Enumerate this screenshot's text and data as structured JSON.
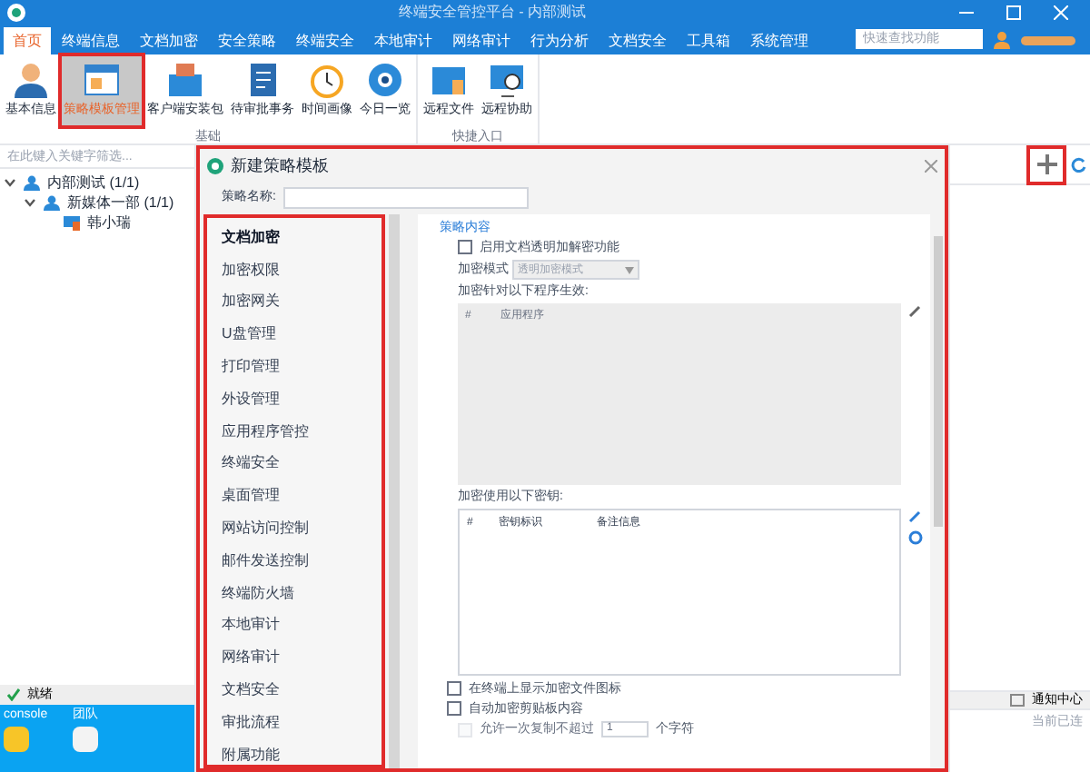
{
  "window": {
    "title": "终端安全管控平台 - 内部测试"
  },
  "menu_tabs": [
    {
      "label": "首页",
      "selected": true
    },
    {
      "label": "终端信息",
      "selected": false
    },
    {
      "label": "文档加密",
      "selected": false
    },
    {
      "label": "安全策略",
      "selected": false
    },
    {
      "label": "终端安全",
      "selected": false
    },
    {
      "label": "本地审计",
      "selected": false
    },
    {
      "label": "网络审计",
      "selected": false
    },
    {
      "label": "行为分析",
      "selected": false
    },
    {
      "label": "文档安全",
      "selected": false
    },
    {
      "label": "工具箱",
      "selected": false
    },
    {
      "label": "系统管理",
      "selected": false
    }
  ],
  "search": {
    "placeholder": "快速查找功能"
  },
  "ribbon_groups": [
    {
      "label": "基础",
      "items": [
        {
          "label": "基本信息",
          "selected": false
        },
        {
          "label": "策略模板管理",
          "selected": true
        },
        {
          "label": "客户端安装包",
          "selected": false
        },
        {
          "label": "待审批事务",
          "selected": false
        },
        {
          "label": "时间画像",
          "selected": false
        },
        {
          "label": "今日一览",
          "selected": false
        }
      ]
    },
    {
      "label": "快捷入口",
      "items": [
        {
          "label": "远程文件",
          "selected": false
        },
        {
          "label": "远程协助",
          "selected": false
        }
      ]
    }
  ],
  "tree": {
    "placeholder": "在此键入关键字筛选...",
    "nodes": [
      {
        "label": "内部测试 (1/1)",
        "expanded": true,
        "children": [
          {
            "label": "新媒体一部 (1/1)",
            "expanded": true,
            "children": [
              {
                "label": "韩小瑞"
              }
            ]
          }
        ]
      }
    ]
  },
  "status_bar": {
    "text": "就绪"
  },
  "desktop": {
    "icons": [
      {
        "label": "console"
      },
      {
        "label": "团队"
      }
    ]
  },
  "right_panel": {
    "notification": "通知中心",
    "status": "当前已连"
  },
  "dialog": {
    "title": "新建策略模板",
    "name_label": "策略名称:",
    "categories": [
      {
        "label": "文档加密",
        "selected": true
      },
      {
        "label": "加密权限",
        "selected": false
      },
      {
        "label": "加密网关",
        "selected": false
      },
      {
        "label": "U盘管理",
        "selected": false
      },
      {
        "label": "打印管理",
        "selected": false
      },
      {
        "label": "外设管理",
        "selected": false
      },
      {
        "label": "应用程序管控",
        "selected": false
      },
      {
        "label": "终端安全",
        "selected": false
      },
      {
        "label": "桌面管理",
        "selected": false
      },
      {
        "label": "网站访问控制",
        "selected": false
      },
      {
        "label": "邮件发送控制",
        "selected": false
      },
      {
        "label": "终端防火墙",
        "selected": false
      },
      {
        "label": "本地审计",
        "selected": false
      },
      {
        "label": "网络审计",
        "selected": false
      },
      {
        "label": "文档安全",
        "selected": false
      },
      {
        "label": "审批流程",
        "selected": false
      },
      {
        "label": "附属功能",
        "selected": false
      }
    ],
    "section_title": "策略内容",
    "enable": {
      "label": "启用文档透明加解密功能",
      "checked": false
    },
    "mode": {
      "label": "加密模式",
      "value": "透明加密模式",
      "disabled": true
    },
    "programs": {
      "label": "加密针对以下程序生效:",
      "columns": [
        "#",
        "应用程序"
      ]
    },
    "keys": {
      "label": "加密使用以下密钥:",
      "columns": [
        "#",
        "密钥标识",
        "备注信息"
      ]
    },
    "options": [
      {
        "kind": "checkbox",
        "label": "在终端上显示加密文件图标",
        "checked": false,
        "disabled": false
      },
      {
        "kind": "checkbox",
        "label": "自动加密剪贴板内容",
        "checked": false,
        "disabled": false
      },
      {
        "kind": "limit",
        "label": "允许一次复制不超过",
        "value": "1",
        "unit": "个字符",
        "checked": false,
        "disabled": true
      }
    ]
  }
}
